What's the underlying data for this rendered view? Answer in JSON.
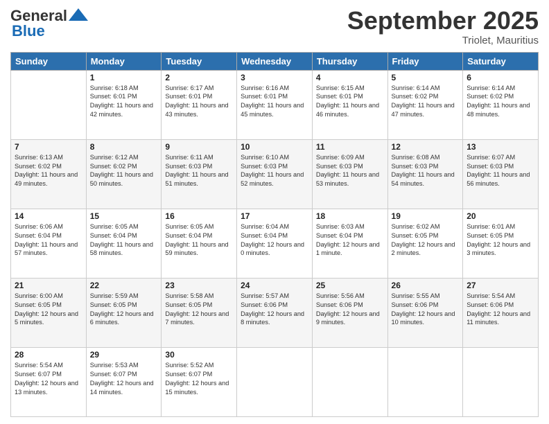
{
  "header": {
    "logo_general": "General",
    "logo_blue": "Blue",
    "month_title": "September 2025",
    "location": "Triolet, Mauritius"
  },
  "days_of_week": [
    "Sunday",
    "Monday",
    "Tuesday",
    "Wednesday",
    "Thursday",
    "Friday",
    "Saturday"
  ],
  "weeks": [
    [
      {
        "day": "",
        "sunrise": "",
        "sunset": "",
        "daylight": ""
      },
      {
        "day": "1",
        "sunrise": "Sunrise: 6:18 AM",
        "sunset": "Sunset: 6:01 PM",
        "daylight": "Daylight: 11 hours and 42 minutes."
      },
      {
        "day": "2",
        "sunrise": "Sunrise: 6:17 AM",
        "sunset": "Sunset: 6:01 PM",
        "daylight": "Daylight: 11 hours and 43 minutes."
      },
      {
        "day": "3",
        "sunrise": "Sunrise: 6:16 AM",
        "sunset": "Sunset: 6:01 PM",
        "daylight": "Daylight: 11 hours and 45 minutes."
      },
      {
        "day": "4",
        "sunrise": "Sunrise: 6:15 AM",
        "sunset": "Sunset: 6:01 PM",
        "daylight": "Daylight: 11 hours and 46 minutes."
      },
      {
        "day": "5",
        "sunrise": "Sunrise: 6:14 AM",
        "sunset": "Sunset: 6:02 PM",
        "daylight": "Daylight: 11 hours and 47 minutes."
      },
      {
        "day": "6",
        "sunrise": "Sunrise: 6:14 AM",
        "sunset": "Sunset: 6:02 PM",
        "daylight": "Daylight: 11 hours and 48 minutes."
      }
    ],
    [
      {
        "day": "7",
        "sunrise": "Sunrise: 6:13 AM",
        "sunset": "Sunset: 6:02 PM",
        "daylight": "Daylight: 11 hours and 49 minutes."
      },
      {
        "day": "8",
        "sunrise": "Sunrise: 6:12 AM",
        "sunset": "Sunset: 6:02 PM",
        "daylight": "Daylight: 11 hours and 50 minutes."
      },
      {
        "day": "9",
        "sunrise": "Sunrise: 6:11 AM",
        "sunset": "Sunset: 6:03 PM",
        "daylight": "Daylight: 11 hours and 51 minutes."
      },
      {
        "day": "10",
        "sunrise": "Sunrise: 6:10 AM",
        "sunset": "Sunset: 6:03 PM",
        "daylight": "Daylight: 11 hours and 52 minutes."
      },
      {
        "day": "11",
        "sunrise": "Sunrise: 6:09 AM",
        "sunset": "Sunset: 6:03 PM",
        "daylight": "Daylight: 11 hours and 53 minutes."
      },
      {
        "day": "12",
        "sunrise": "Sunrise: 6:08 AM",
        "sunset": "Sunset: 6:03 PM",
        "daylight": "Daylight: 11 hours and 54 minutes."
      },
      {
        "day": "13",
        "sunrise": "Sunrise: 6:07 AM",
        "sunset": "Sunset: 6:03 PM",
        "daylight": "Daylight: 11 hours and 56 minutes."
      }
    ],
    [
      {
        "day": "14",
        "sunrise": "Sunrise: 6:06 AM",
        "sunset": "Sunset: 6:04 PM",
        "daylight": "Daylight: 11 hours and 57 minutes."
      },
      {
        "day": "15",
        "sunrise": "Sunrise: 6:05 AM",
        "sunset": "Sunset: 6:04 PM",
        "daylight": "Daylight: 11 hours and 58 minutes."
      },
      {
        "day": "16",
        "sunrise": "Sunrise: 6:05 AM",
        "sunset": "Sunset: 6:04 PM",
        "daylight": "Daylight: 11 hours and 59 minutes."
      },
      {
        "day": "17",
        "sunrise": "Sunrise: 6:04 AM",
        "sunset": "Sunset: 6:04 PM",
        "daylight": "Daylight: 12 hours and 0 minutes."
      },
      {
        "day": "18",
        "sunrise": "Sunrise: 6:03 AM",
        "sunset": "Sunset: 6:04 PM",
        "daylight": "Daylight: 12 hours and 1 minute."
      },
      {
        "day": "19",
        "sunrise": "Sunrise: 6:02 AM",
        "sunset": "Sunset: 6:05 PM",
        "daylight": "Daylight: 12 hours and 2 minutes."
      },
      {
        "day": "20",
        "sunrise": "Sunrise: 6:01 AM",
        "sunset": "Sunset: 6:05 PM",
        "daylight": "Daylight: 12 hours and 3 minutes."
      }
    ],
    [
      {
        "day": "21",
        "sunrise": "Sunrise: 6:00 AM",
        "sunset": "Sunset: 6:05 PM",
        "daylight": "Daylight: 12 hours and 5 minutes."
      },
      {
        "day": "22",
        "sunrise": "Sunrise: 5:59 AM",
        "sunset": "Sunset: 6:05 PM",
        "daylight": "Daylight: 12 hours and 6 minutes."
      },
      {
        "day": "23",
        "sunrise": "Sunrise: 5:58 AM",
        "sunset": "Sunset: 6:05 PM",
        "daylight": "Daylight: 12 hours and 7 minutes."
      },
      {
        "day": "24",
        "sunrise": "Sunrise: 5:57 AM",
        "sunset": "Sunset: 6:06 PM",
        "daylight": "Daylight: 12 hours and 8 minutes."
      },
      {
        "day": "25",
        "sunrise": "Sunrise: 5:56 AM",
        "sunset": "Sunset: 6:06 PM",
        "daylight": "Daylight: 12 hours and 9 minutes."
      },
      {
        "day": "26",
        "sunrise": "Sunrise: 5:55 AM",
        "sunset": "Sunset: 6:06 PM",
        "daylight": "Daylight: 12 hours and 10 minutes."
      },
      {
        "day": "27",
        "sunrise": "Sunrise: 5:54 AM",
        "sunset": "Sunset: 6:06 PM",
        "daylight": "Daylight: 12 hours and 11 minutes."
      }
    ],
    [
      {
        "day": "28",
        "sunrise": "Sunrise: 5:54 AM",
        "sunset": "Sunset: 6:07 PM",
        "daylight": "Daylight: 12 hours and 13 minutes."
      },
      {
        "day": "29",
        "sunrise": "Sunrise: 5:53 AM",
        "sunset": "Sunset: 6:07 PM",
        "daylight": "Daylight: 12 hours and 14 minutes."
      },
      {
        "day": "30",
        "sunrise": "Sunrise: 5:52 AM",
        "sunset": "Sunset: 6:07 PM",
        "daylight": "Daylight: 12 hours and 15 minutes."
      },
      {
        "day": "",
        "sunrise": "",
        "sunset": "",
        "daylight": ""
      },
      {
        "day": "",
        "sunrise": "",
        "sunset": "",
        "daylight": ""
      },
      {
        "day": "",
        "sunrise": "",
        "sunset": "",
        "daylight": ""
      },
      {
        "day": "",
        "sunrise": "",
        "sunset": "",
        "daylight": ""
      }
    ]
  ]
}
